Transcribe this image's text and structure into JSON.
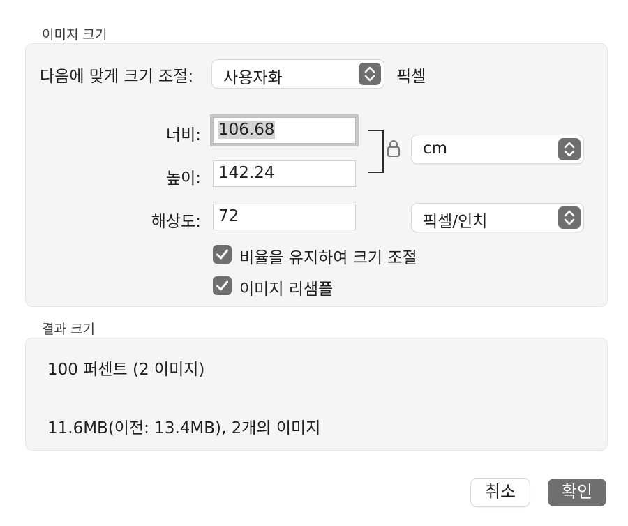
{
  "image_size_section": {
    "title": "이미지 크기",
    "fit_label": "다음에 맞게 크기 조절:",
    "fit_value": "사용자화",
    "fit_unit": "픽셀",
    "width_label": "너비:",
    "width_value": "106.68",
    "height_label": "높이:",
    "height_value": "142.24",
    "dimension_unit": "cm",
    "resolution_label": "해상도:",
    "resolution_value": "72",
    "resolution_unit": "픽셀/인치",
    "scale_proportionally": {
      "label": "비율을 유지하여 크기 조절",
      "checked": true
    },
    "resample": {
      "label": "이미지 리샘플",
      "checked": true
    }
  },
  "result_section": {
    "title": "결과 크기",
    "percent": "100 퍼센트 (2 이미지)",
    "size": "11.6MB(이전: 13.4MB), 2개의 이미지"
  },
  "buttons": {
    "cancel": "취소",
    "ok": "확인"
  },
  "colors": {
    "panel_bg": "#f5f5f5",
    "accent_gray": "#6e6e6e",
    "focus_ring": "#c6c6c6"
  }
}
